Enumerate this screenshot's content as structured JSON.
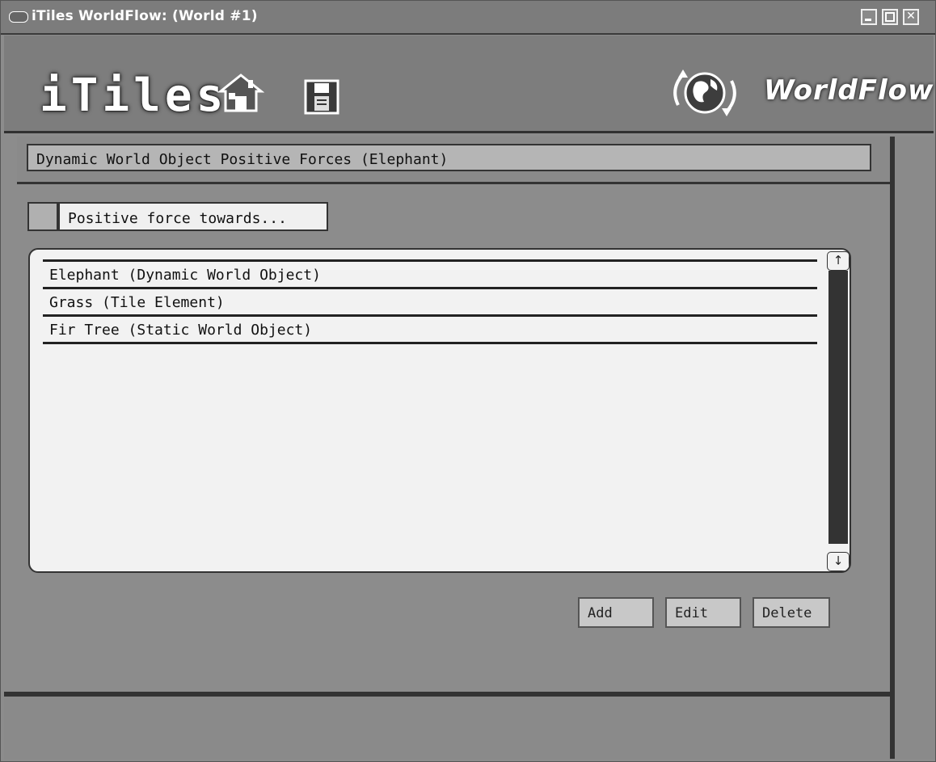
{
  "window": {
    "title": "iTiles WorldFlow: (World #1)"
  },
  "header": {
    "logo_text": "iTiles",
    "brand_text": "WorldFlow"
  },
  "subheader": {
    "title": "Dynamic World Object Positive Forces (Elephant)"
  },
  "force_section": {
    "label": "Positive force towards..."
  },
  "list": {
    "items": [
      "Elephant (Dynamic World Object)",
      "Grass (Tile Element)",
      "Fir Tree (Static World Object)"
    ],
    "scroll_up": "↑",
    "scroll_down": "↓"
  },
  "actions": {
    "add": "Add",
    "edit": "Edit",
    "delete": "Delete"
  },
  "icons": {
    "house": "house-icon",
    "save": "floppy-disk-icon",
    "globe": "globe-arrows-icon"
  }
}
